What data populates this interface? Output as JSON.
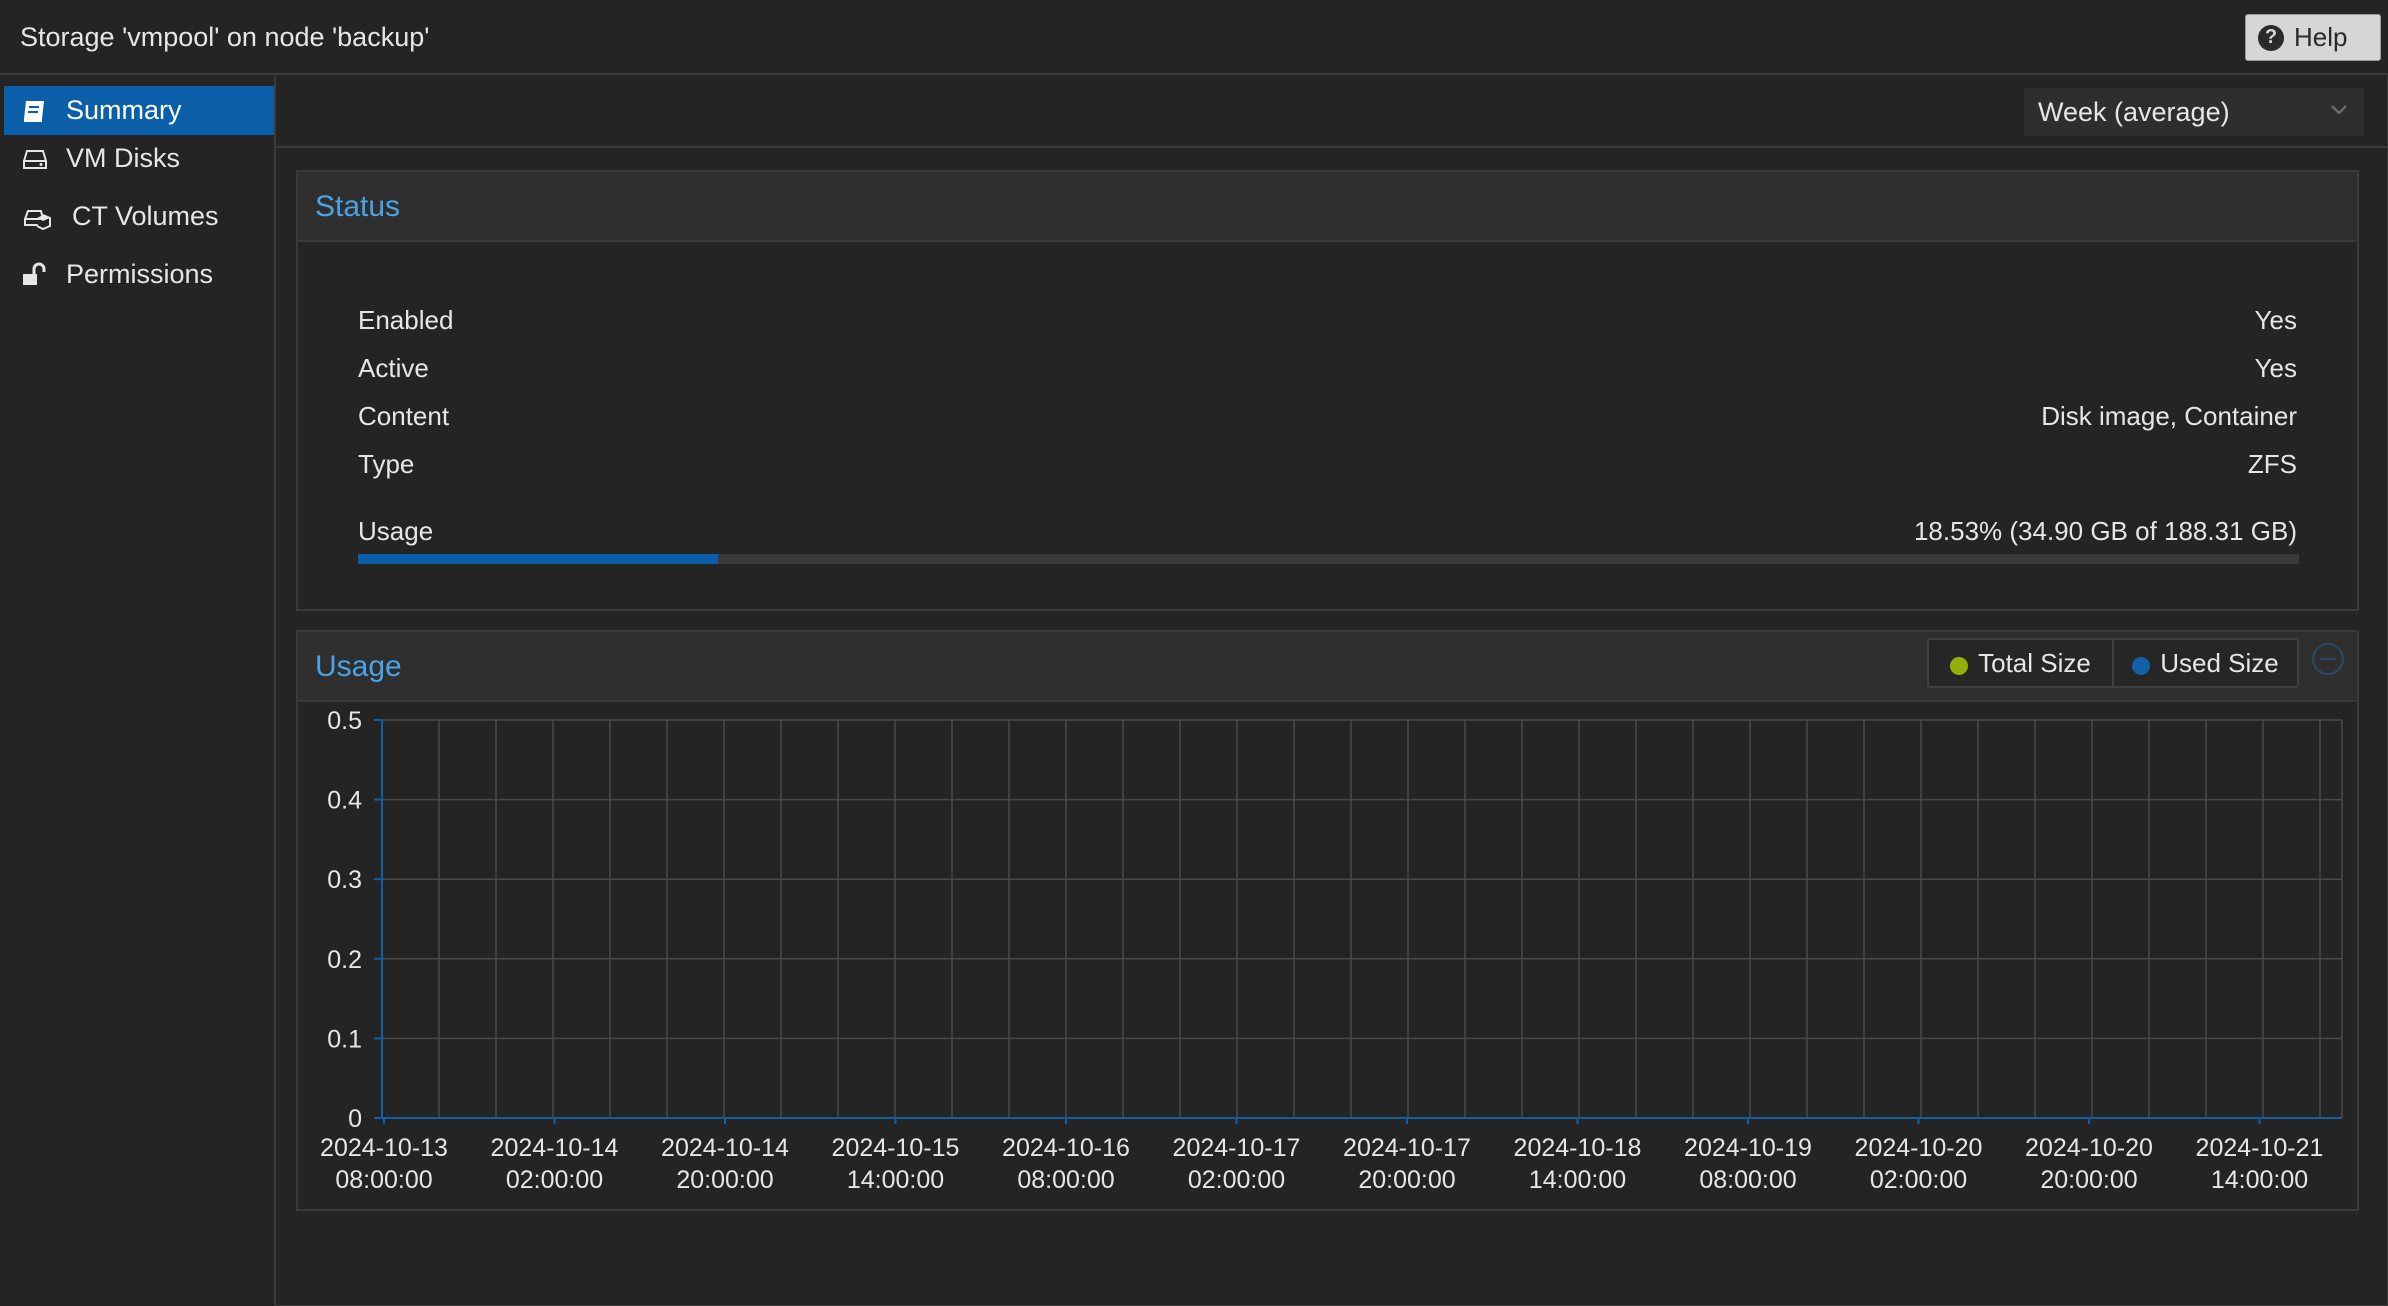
{
  "window": {
    "title": "Storage 'vmpool' on node 'backup'"
  },
  "help_button": {
    "label": "Help",
    "icon": "question-circle-icon"
  },
  "sidebar": {
    "items": [
      {
        "label": "Summary",
        "icon": "book-icon",
        "active": true
      },
      {
        "label": "VM Disks",
        "icon": "hdd-icon",
        "active": false
      },
      {
        "label": "CT Volumes",
        "icon": "hdd-cube-icon",
        "active": false
      },
      {
        "label": "Permissions",
        "icon": "unlock-icon",
        "active": false
      }
    ]
  },
  "timeframe": {
    "selected": "Week (average)"
  },
  "status": {
    "title": "Status",
    "rows": [
      {
        "label": "Enabled",
        "value": "Yes"
      },
      {
        "label": "Active",
        "value": "Yes"
      },
      {
        "label": "Content",
        "value": "Disk image, Container"
      },
      {
        "label": "Type",
        "value": "ZFS"
      }
    ],
    "usage": {
      "label": "Usage",
      "value": "18.53% (34.90 GB of 188.31 GB)",
      "percent": 18.53
    }
  },
  "usage_chart": {
    "title": "Usage",
    "legend": [
      {
        "label": "Total Size",
        "color": "#94ae0a"
      },
      {
        "label": "Used Size",
        "color": "#115fa6"
      }
    ]
  },
  "chart_data": {
    "type": "area",
    "title": "Usage",
    "xlabel": "",
    "ylabel": "",
    "ylim": [
      0,
      0.5
    ],
    "y_ticks": [
      "0",
      "0.1",
      "0.2",
      "0.3",
      "0.4",
      "0.5"
    ],
    "x_ticks": [
      [
        "2024-10-13",
        "08:00:00"
      ],
      [
        "2024-10-14",
        "02:00:00"
      ],
      [
        "2024-10-14",
        "20:00:00"
      ],
      [
        "2024-10-15",
        "14:00:00"
      ],
      [
        "2024-10-16",
        "08:00:00"
      ],
      [
        "2024-10-17",
        "02:00:00"
      ],
      [
        "2024-10-17",
        "20:00:00"
      ],
      [
        "2024-10-18",
        "14:00:00"
      ],
      [
        "2024-10-19",
        "08:00:00"
      ],
      [
        "2024-10-20",
        "02:00:00"
      ],
      [
        "2024-10-20",
        "20:00:00"
      ],
      [
        "2024-10-21",
        "14:00:00"
      ]
    ],
    "grid": true,
    "series": [
      {
        "name": "Total Size",
        "values": []
      },
      {
        "name": "Used Size",
        "values": []
      }
    ]
  },
  "colors": {
    "accent": "#0b5fa8",
    "title_blue": "#4aa3e6",
    "background": "#242424"
  }
}
